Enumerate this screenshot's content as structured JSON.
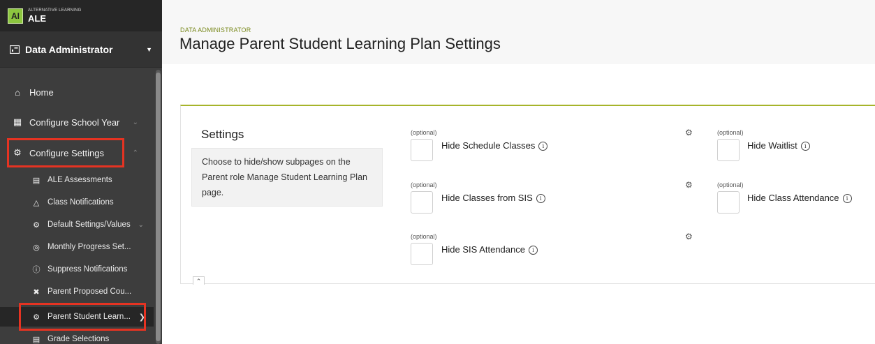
{
  "app": {
    "logo_text": "AI",
    "subtitle": "ALTERNATIVE LEARNING",
    "name": "ALE"
  },
  "role_selector": {
    "label": "Data Administrator"
  },
  "nav": {
    "home": "Home",
    "configure_school_year": "Configure School Year",
    "configure_settings": "Configure Settings",
    "sub_items": [
      "ALE Assessments",
      "Class Notifications",
      "Default Settings/Values",
      "Monthly Progress Set...",
      "Suppress Notifications",
      "Parent Proposed Cou...",
      "Parent Student Learn...",
      "Grade Selections"
    ]
  },
  "header": {
    "eyebrow": "DATA ADMINISTRATOR",
    "title": "Manage Parent Student Learning Plan Settings"
  },
  "settings": {
    "title": "Settings",
    "description": "Choose to hide/show subpages on the Parent role Manage Student Learning Plan page.",
    "optional_label": "(optional)",
    "fields": [
      {
        "label": "Hide Schedule Classes",
        "checked": false
      },
      {
        "label": "Hide Waitlist",
        "checked": false
      },
      {
        "label": "Hide Classes from SIS",
        "checked": false
      },
      {
        "label": "Hide Class Attendance",
        "checked": false
      },
      {
        "label": "Hide SIS Attendance",
        "checked": false
      }
    ]
  },
  "colors": {
    "sidebar_bg": "#3d3d3d",
    "brand_green": "#8cc63f",
    "accent_olive": "#a6b42b",
    "highlight_red": "#e53322"
  }
}
